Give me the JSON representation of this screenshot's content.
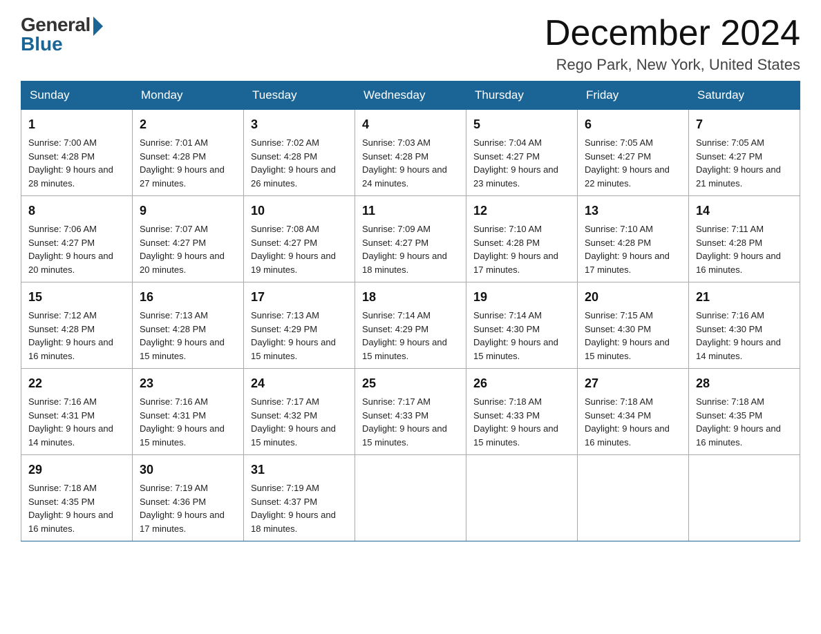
{
  "header": {
    "logo_general": "General",
    "logo_blue": "Blue",
    "month_title": "December 2024",
    "location": "Rego Park, New York, United States"
  },
  "days_of_week": [
    "Sunday",
    "Monday",
    "Tuesday",
    "Wednesday",
    "Thursday",
    "Friday",
    "Saturday"
  ],
  "weeks": [
    [
      {
        "day": "1",
        "sunrise": "7:00 AM",
        "sunset": "4:28 PM",
        "daylight": "9 hours and 28 minutes."
      },
      {
        "day": "2",
        "sunrise": "7:01 AM",
        "sunset": "4:28 PM",
        "daylight": "9 hours and 27 minutes."
      },
      {
        "day": "3",
        "sunrise": "7:02 AM",
        "sunset": "4:28 PM",
        "daylight": "9 hours and 26 minutes."
      },
      {
        "day": "4",
        "sunrise": "7:03 AM",
        "sunset": "4:28 PM",
        "daylight": "9 hours and 24 minutes."
      },
      {
        "day": "5",
        "sunrise": "7:04 AM",
        "sunset": "4:27 PM",
        "daylight": "9 hours and 23 minutes."
      },
      {
        "day": "6",
        "sunrise": "7:05 AM",
        "sunset": "4:27 PM",
        "daylight": "9 hours and 22 minutes."
      },
      {
        "day": "7",
        "sunrise": "7:05 AM",
        "sunset": "4:27 PM",
        "daylight": "9 hours and 21 minutes."
      }
    ],
    [
      {
        "day": "8",
        "sunrise": "7:06 AM",
        "sunset": "4:27 PM",
        "daylight": "9 hours and 20 minutes."
      },
      {
        "day": "9",
        "sunrise": "7:07 AM",
        "sunset": "4:27 PM",
        "daylight": "9 hours and 20 minutes."
      },
      {
        "day": "10",
        "sunrise": "7:08 AM",
        "sunset": "4:27 PM",
        "daylight": "9 hours and 19 minutes."
      },
      {
        "day": "11",
        "sunrise": "7:09 AM",
        "sunset": "4:27 PM",
        "daylight": "9 hours and 18 minutes."
      },
      {
        "day": "12",
        "sunrise": "7:10 AM",
        "sunset": "4:28 PM",
        "daylight": "9 hours and 17 minutes."
      },
      {
        "day": "13",
        "sunrise": "7:10 AM",
        "sunset": "4:28 PM",
        "daylight": "9 hours and 17 minutes."
      },
      {
        "day": "14",
        "sunrise": "7:11 AM",
        "sunset": "4:28 PM",
        "daylight": "9 hours and 16 minutes."
      }
    ],
    [
      {
        "day": "15",
        "sunrise": "7:12 AM",
        "sunset": "4:28 PM",
        "daylight": "9 hours and 16 minutes."
      },
      {
        "day": "16",
        "sunrise": "7:13 AM",
        "sunset": "4:28 PM",
        "daylight": "9 hours and 15 minutes."
      },
      {
        "day": "17",
        "sunrise": "7:13 AM",
        "sunset": "4:29 PM",
        "daylight": "9 hours and 15 minutes."
      },
      {
        "day": "18",
        "sunrise": "7:14 AM",
        "sunset": "4:29 PM",
        "daylight": "9 hours and 15 minutes."
      },
      {
        "day": "19",
        "sunrise": "7:14 AM",
        "sunset": "4:30 PM",
        "daylight": "9 hours and 15 minutes."
      },
      {
        "day": "20",
        "sunrise": "7:15 AM",
        "sunset": "4:30 PM",
        "daylight": "9 hours and 15 minutes."
      },
      {
        "day": "21",
        "sunrise": "7:16 AM",
        "sunset": "4:30 PM",
        "daylight": "9 hours and 14 minutes."
      }
    ],
    [
      {
        "day": "22",
        "sunrise": "7:16 AM",
        "sunset": "4:31 PM",
        "daylight": "9 hours and 14 minutes."
      },
      {
        "day": "23",
        "sunrise": "7:16 AM",
        "sunset": "4:31 PM",
        "daylight": "9 hours and 15 minutes."
      },
      {
        "day": "24",
        "sunrise": "7:17 AM",
        "sunset": "4:32 PM",
        "daylight": "9 hours and 15 minutes."
      },
      {
        "day": "25",
        "sunrise": "7:17 AM",
        "sunset": "4:33 PM",
        "daylight": "9 hours and 15 minutes."
      },
      {
        "day": "26",
        "sunrise": "7:18 AM",
        "sunset": "4:33 PM",
        "daylight": "9 hours and 15 minutes."
      },
      {
        "day": "27",
        "sunrise": "7:18 AM",
        "sunset": "4:34 PM",
        "daylight": "9 hours and 16 minutes."
      },
      {
        "day": "28",
        "sunrise": "7:18 AM",
        "sunset": "4:35 PM",
        "daylight": "9 hours and 16 minutes."
      }
    ],
    [
      {
        "day": "29",
        "sunrise": "7:18 AM",
        "sunset": "4:35 PM",
        "daylight": "9 hours and 16 minutes."
      },
      {
        "day": "30",
        "sunrise": "7:19 AM",
        "sunset": "4:36 PM",
        "daylight": "9 hours and 17 minutes."
      },
      {
        "day": "31",
        "sunrise": "7:19 AM",
        "sunset": "4:37 PM",
        "daylight": "9 hours and 18 minutes."
      },
      null,
      null,
      null,
      null
    ]
  ]
}
